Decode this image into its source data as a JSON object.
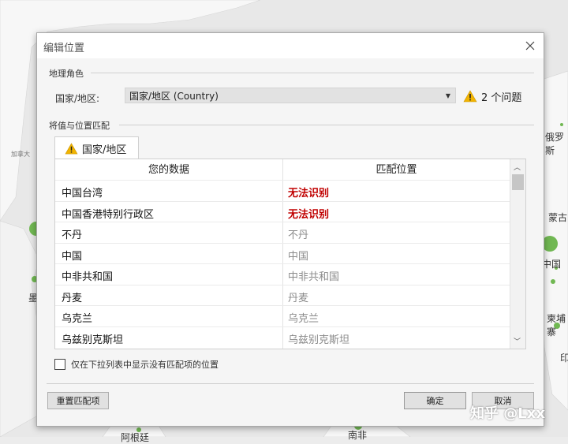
{
  "map": {
    "labels": [
      "加拿大",
      "俄罗斯",
      "蒙古",
      "中国",
      "柬埔寨",
      "印",
      "墨",
      "南非",
      "阿根廷"
    ],
    "bubble_color": "#71b853"
  },
  "dialog": {
    "title": "编辑位置",
    "geo_role_section": "地理角色",
    "field_label": "国家/地区:",
    "select_value": "国家/地区 (Country)",
    "issues_label": "2 个问题",
    "match_section": "将值与位置匹配",
    "tab_label": "国家/地区",
    "columns": [
      "您的数据",
      "匹配位置"
    ],
    "rows": [
      {
        "data": "中国台湾",
        "match": "无法识别",
        "status": "unknown"
      },
      {
        "data": "中国香港特别行政区",
        "match": "无法识别",
        "status": "unknown"
      },
      {
        "data": "不丹",
        "match": "不丹",
        "status": "matched"
      },
      {
        "data": "中国",
        "match": "中国",
        "status": "matched"
      },
      {
        "data": "中非共和国",
        "match": "中非共和国",
        "status": "matched"
      },
      {
        "data": "丹麦",
        "match": "丹麦",
        "status": "matched"
      },
      {
        "data": "乌克兰",
        "match": "乌克兰",
        "status": "matched"
      },
      {
        "data": "乌兹别克斯坦",
        "match": "乌兹别克斯坦",
        "status": "matched"
      }
    ],
    "checkbox_label": "仅在下拉列表中显示没有匹配项的位置",
    "reset_button": "重置匹配项",
    "ok_button": "确定",
    "cancel_button": "取消"
  },
  "watermark": "知乎 @Lxx",
  "colors": {
    "unrecognized": "#c00000",
    "matched": "#8a8a8a",
    "warning": "#f2b400"
  }
}
